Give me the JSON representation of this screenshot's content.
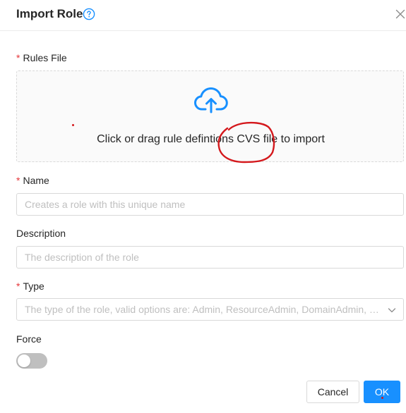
{
  "dialog": {
    "title": "Import Role",
    "cancel_label": "Cancel",
    "ok_label": "OK"
  },
  "form": {
    "rules_file": {
      "required_mark": "*",
      "label": "Rules File",
      "upload_text": "Click or drag rule defintions CVS file to import"
    },
    "name": {
      "required_mark": "*",
      "label": "Name",
      "placeholder": "Creates a role with this unique name"
    },
    "description": {
      "label": "Description",
      "placeholder": "The description of the role"
    },
    "type": {
      "required_mark": "*",
      "label": "Type",
      "placeholder": "The type of the role, valid options are: Admin, ResourceAdmin, DomainAdmin, User"
    },
    "force": {
      "label": "Force",
      "enabled": false
    }
  },
  "colors": {
    "primary": "#1890ff",
    "required": "#e5363a",
    "annotation": "#d4181c",
    "toggle_off": "#bfbfbf"
  },
  "icons": [
    "help-circle-icon",
    "close-icon",
    "cloud-upload-icon",
    "chevron-down-icon"
  ]
}
